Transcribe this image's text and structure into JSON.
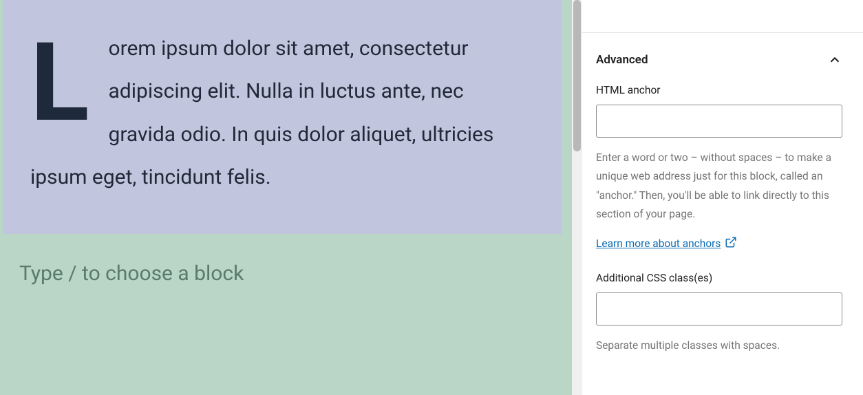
{
  "editor": {
    "dropcap_letter": "L",
    "paragraph_text": "orem ipsum dolor sit amet, consectetur adipiscing elit. Nulla in luctus ante, nec gravida odio. In quis dolor aliquet, ultricies ipsum eget, tincidunt felis.",
    "placeholder": "Type / to choose a block"
  },
  "sidebar": {
    "advanced": {
      "title": "Advanced",
      "html_anchor": {
        "label": "HTML anchor",
        "value": "",
        "help": "Enter a word or two – without spaces – to make a unique web address just for this block, called an \"anchor.\" Then, you'll be able to link directly to this section of your page.",
        "link_text": "Learn more about anchors"
      },
      "css_classes": {
        "label": "Additional CSS class(es)",
        "value": "",
        "help": "Separate multiple classes with spaces."
      }
    }
  }
}
